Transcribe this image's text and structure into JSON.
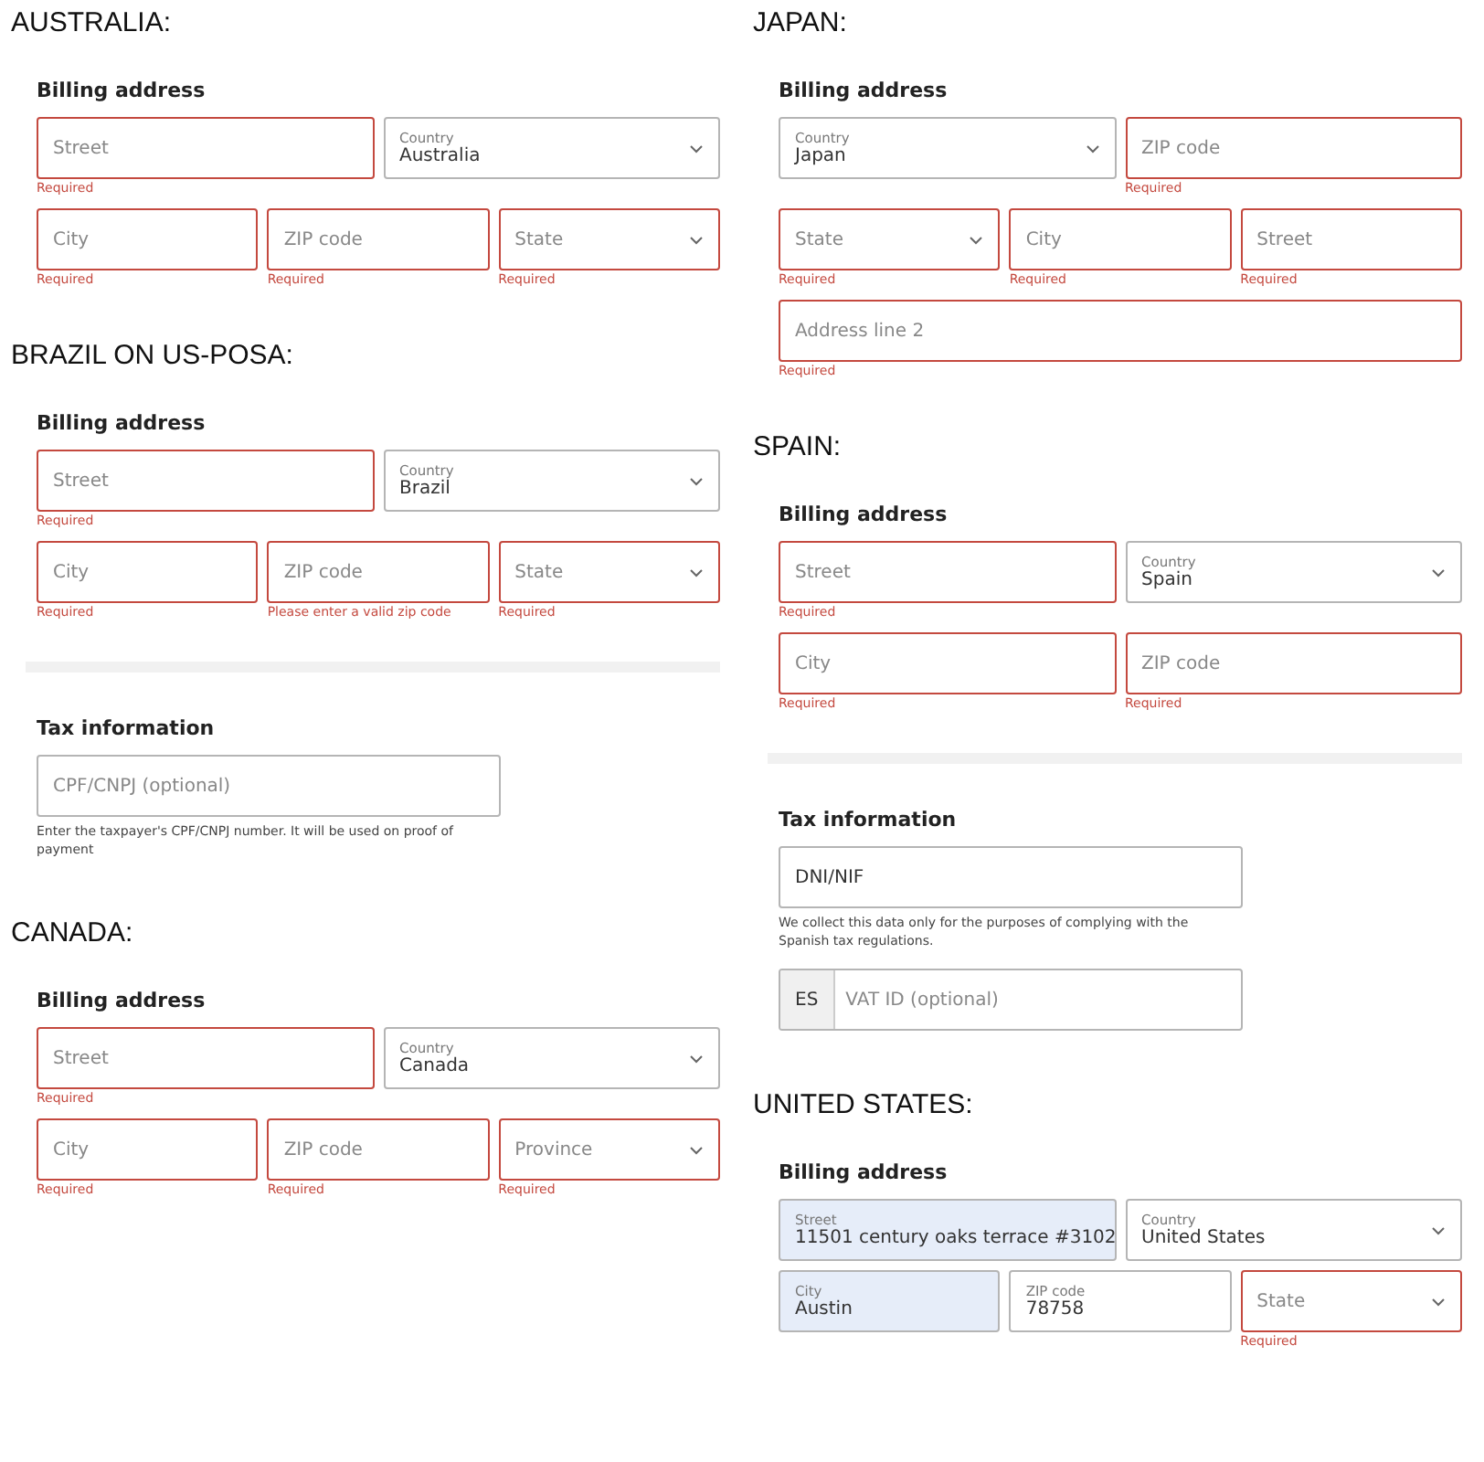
{
  "columns": [
    {
      "sections": [
        {
          "heading": "AUSTRALIA:",
          "billing": {
            "title": "Billing address",
            "rows": [
              {
                "fields": [
                  {
                    "kind": "input",
                    "placeholder": "Street",
                    "invalid": true,
                    "message": "Required"
                  },
                  {
                    "kind": "select",
                    "label": "Country",
                    "value": "Australia",
                    "invalid": false
                  }
                ]
              },
              {
                "fields": [
                  {
                    "kind": "input",
                    "placeholder": "City",
                    "invalid": true,
                    "message": "Required"
                  },
                  {
                    "kind": "input",
                    "placeholder": "ZIP code",
                    "invalid": true,
                    "message": "Required"
                  },
                  {
                    "kind": "select",
                    "placeholder": "State",
                    "invalid": true,
                    "message": "Required"
                  }
                ]
              }
            ]
          }
        },
        {
          "heading": "BRAZIL ON US-POSA:",
          "billing": {
            "title": "Billing address",
            "rows": [
              {
                "fields": [
                  {
                    "kind": "input",
                    "placeholder": "Street",
                    "invalid": true,
                    "message": "Required"
                  },
                  {
                    "kind": "select",
                    "label": "Country",
                    "value": "Brazil",
                    "invalid": false
                  }
                ]
              },
              {
                "fields": [
                  {
                    "kind": "input",
                    "placeholder": "City",
                    "invalid": true,
                    "message": "Required"
                  },
                  {
                    "kind": "input",
                    "placeholder": "ZIP code",
                    "invalid": true,
                    "message": "Please enter a valid zip code"
                  },
                  {
                    "kind": "select",
                    "placeholder": "State",
                    "invalid": true,
                    "message": "Required"
                  }
                ]
              }
            ]
          },
          "tax": {
            "title": "Tax information",
            "fields": [
              {
                "kind": "input",
                "placeholder": "CPF/CNPJ (optional)",
                "invalid": false,
                "note": "Enter the taxpayer's CPF/CNPJ number. It will be used on proof of payment"
              }
            ]
          }
        },
        {
          "heading": "CANADA:",
          "billing": {
            "title": "Billing address",
            "rows": [
              {
                "fields": [
                  {
                    "kind": "input",
                    "placeholder": "Street",
                    "invalid": true,
                    "message": "Required"
                  },
                  {
                    "kind": "select",
                    "label": "Country",
                    "value": "Canada",
                    "invalid": false
                  }
                ]
              },
              {
                "fields": [
                  {
                    "kind": "input",
                    "placeholder": "City",
                    "invalid": true,
                    "message": "Required"
                  },
                  {
                    "kind": "input",
                    "placeholder": "ZIP code",
                    "invalid": true,
                    "message": "Required"
                  },
                  {
                    "kind": "select",
                    "placeholder": "Province",
                    "invalid": true,
                    "message": "Required"
                  }
                ]
              }
            ]
          }
        }
      ]
    },
    {
      "sections": [
        {
          "heading": "JAPAN:",
          "billing": {
            "title": "Billing address",
            "rows": [
              {
                "fields": [
                  {
                    "kind": "select",
                    "label": "Country",
                    "value": "Japan",
                    "invalid": false
                  },
                  {
                    "kind": "input",
                    "placeholder": "ZIP code",
                    "invalid": true,
                    "message": "Required"
                  }
                ]
              },
              {
                "fields": [
                  {
                    "kind": "select",
                    "placeholder": "State",
                    "invalid": true,
                    "message": "Required"
                  },
                  {
                    "kind": "input",
                    "placeholder": "City",
                    "invalid": true,
                    "message": "Required"
                  },
                  {
                    "kind": "input",
                    "placeholder": "Street",
                    "invalid": true,
                    "message": "Required"
                  }
                ]
              },
              {
                "fields": [
                  {
                    "kind": "input",
                    "placeholder": "Address line 2",
                    "invalid": true,
                    "message": "Required"
                  }
                ]
              }
            ]
          }
        },
        {
          "heading": "SPAIN:",
          "billing": {
            "title": "Billing address",
            "rows": [
              {
                "fields": [
                  {
                    "kind": "input",
                    "placeholder": "Street",
                    "invalid": true,
                    "message": "Required"
                  },
                  {
                    "kind": "select",
                    "label": "Country",
                    "value": "Spain",
                    "invalid": false
                  }
                ]
              },
              {
                "fields": [
                  {
                    "kind": "input",
                    "placeholder": "City",
                    "invalid": true,
                    "message": "Required"
                  },
                  {
                    "kind": "input",
                    "placeholder": "ZIP code",
                    "invalid": true,
                    "message": "Required"
                  }
                ]
              }
            ]
          },
          "tax": {
            "title": "Tax information",
            "fields": [
              {
                "kind": "input",
                "value": "DNI/NIF",
                "invalid": false,
                "note": "We collect this data only for the purposes of complying with the Spanish tax regulations."
              },
              {
                "kind": "prefixed",
                "prefix": "ES",
                "placeholder": "VAT ID (optional)",
                "invalid": false
              }
            ]
          }
        },
        {
          "heading": "UNITED STATES:",
          "billing": {
            "title": "Billing address",
            "rows": [
              {
                "fields": [
                  {
                    "kind": "input",
                    "label": "Street",
                    "value": "11501 century oaks terrace #3102",
                    "invalid": false,
                    "autofilled": true
                  },
                  {
                    "kind": "select",
                    "label": "Country",
                    "value": "United States",
                    "invalid": false,
                    "autofilled": false
                  }
                ]
              },
              {
                "fields": [
                  {
                    "kind": "input",
                    "label": "City",
                    "value": "Austin",
                    "invalid": false,
                    "autofilled": true
                  },
                  {
                    "kind": "input",
                    "label": "ZIP code",
                    "value": "78758",
                    "invalid": false,
                    "autofilled": false
                  },
                  {
                    "kind": "select",
                    "placeholder": "State",
                    "invalid": true,
                    "autofilled": false,
                    "message": "Required"
                  }
                ]
              }
            ]
          }
        }
      ]
    }
  ]
}
